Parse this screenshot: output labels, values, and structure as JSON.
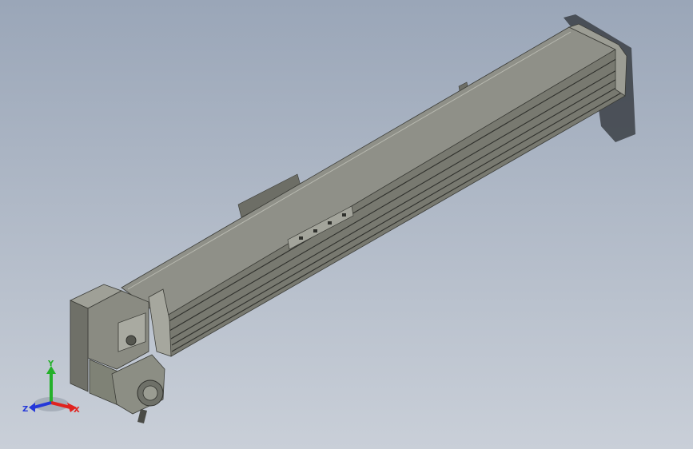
{
  "viewport": {
    "background_top": "#9aa6b8",
    "background_bottom": "#c9cfd8"
  },
  "model": {
    "component": "linear-actuator",
    "body_color": "#8e8f84",
    "motor_color": "#7f8276"
  },
  "triad": {
    "x_label": "X",
    "y_label": "Y",
    "z_label": "Z",
    "x_color": "#e0231f",
    "y_color": "#24b02a",
    "z_color": "#2438d9"
  }
}
